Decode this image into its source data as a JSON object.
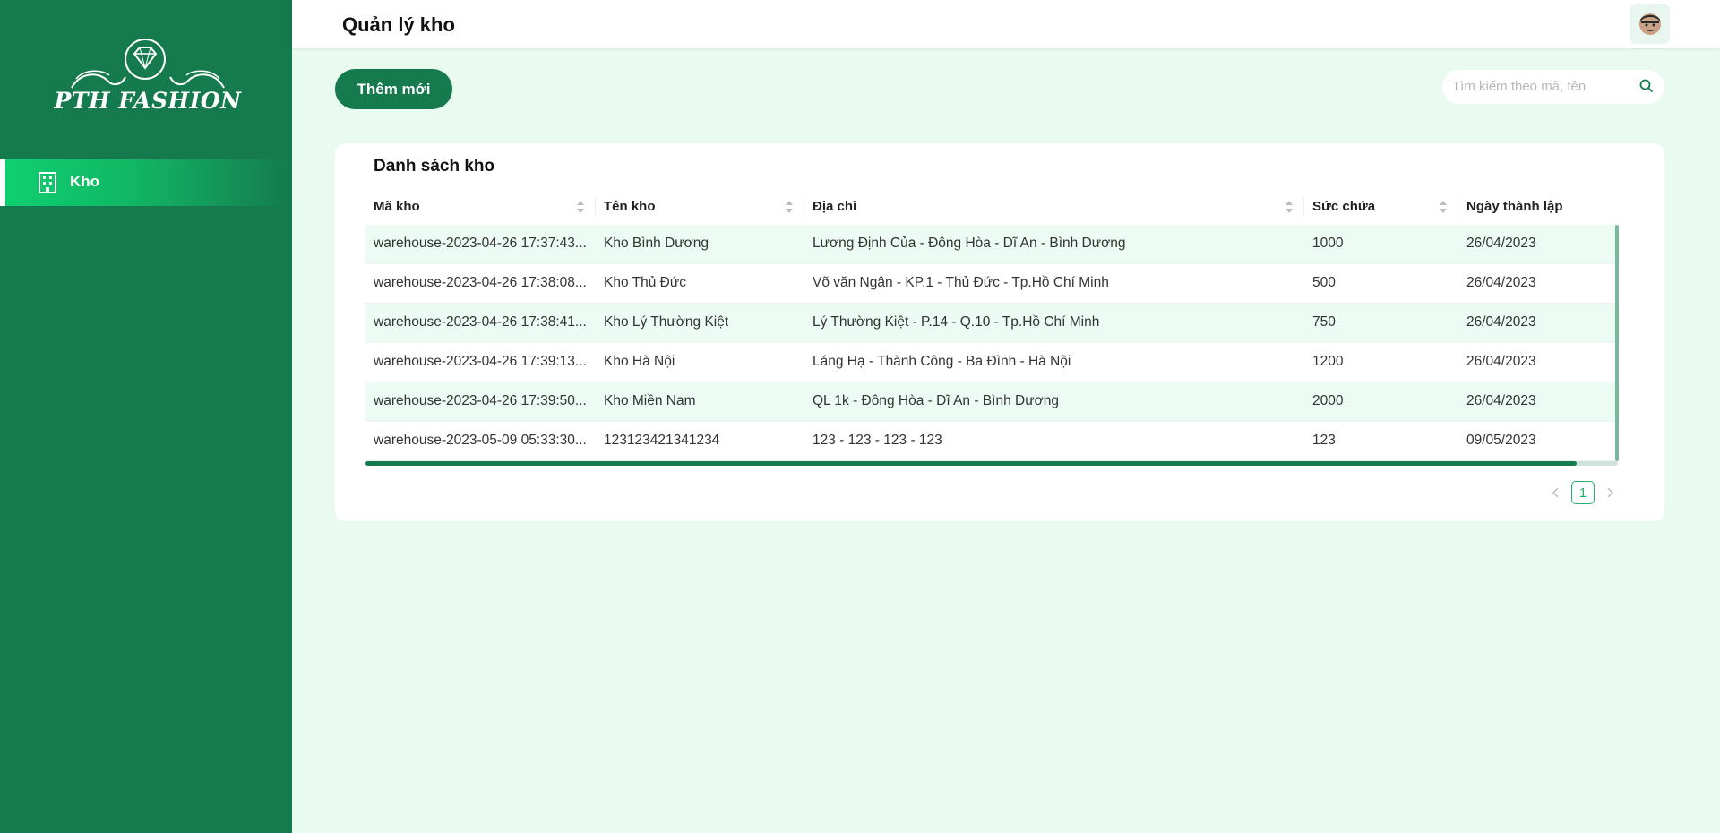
{
  "brand": {
    "name": "PTH FASHION"
  },
  "sidebar": {
    "items": [
      {
        "label": "Kho",
        "icon": "building-icon",
        "active": true
      }
    ]
  },
  "header": {
    "title": "Quản lý kho",
    "avatar_icon": "avatar-icon"
  },
  "toolbar": {
    "add_label": "Thêm mới"
  },
  "search": {
    "placeholder": "Tìm kiếm theo mã, tên"
  },
  "card": {
    "title": "Danh sách kho"
  },
  "table": {
    "columns": [
      "Mã kho",
      "Tên kho",
      "Địa chỉ",
      "Sức chứa",
      "Ngày thành lập"
    ],
    "rows": [
      [
        "warehouse-2023-04-26 17:37:43...",
        "Kho Bình Dương",
        "Lương Định Của - Đông Hòa - Dĩ An - Bình Dương",
        "1000",
        "26/04/2023"
      ],
      [
        "warehouse-2023-04-26 17:38:08...",
        "Kho Thủ Đức",
        "Võ văn Ngân - KP.1 - Thủ Đức - Tp.Hồ Chí Minh",
        "500",
        "26/04/2023"
      ],
      [
        "warehouse-2023-04-26 17:38:41...",
        "Kho Lý Thường Kiệt",
        "Lý Thường Kiệt - P.14 - Q.10 - Tp.Hồ Chí Minh",
        "750",
        "26/04/2023"
      ],
      [
        "warehouse-2023-04-26 17:39:13...",
        "Kho Hà Nội",
        "Láng Hạ - Thành Công - Ba Đình - Hà Nội",
        "1200",
        "26/04/2023"
      ],
      [
        "warehouse-2023-04-26 17:39:50...",
        "Kho Miền Nam",
        "QL 1k - Đông Hòa - Dĩ An - Bình Dương",
        "2000",
        "26/04/2023"
      ],
      [
        "warehouse-2023-05-09 05:33:30...",
        "123123421341234",
        "123 - 123 - 123 - 123",
        "123",
        "09/05/2023"
      ]
    ]
  },
  "pagination": {
    "current": "1"
  },
  "colors": {
    "primary": "#157a4e",
    "accent": "#0fd071",
    "background": "#e9faf1"
  }
}
